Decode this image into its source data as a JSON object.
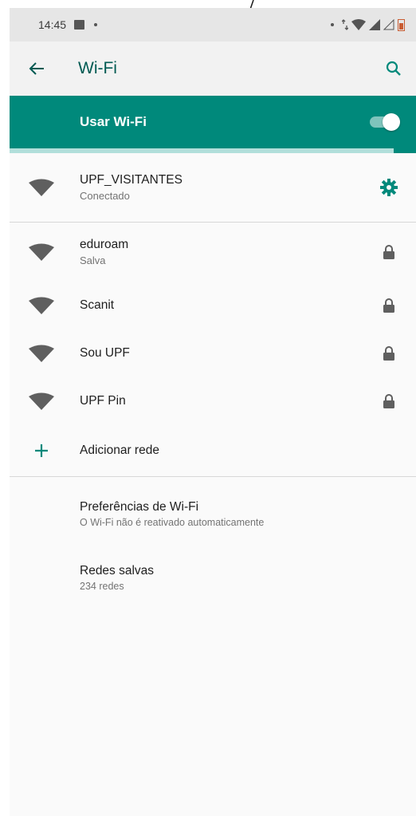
{
  "status_bar": {
    "time": "14:45"
  },
  "app_bar": {
    "title": "Wi-Fi"
  },
  "master_switch": {
    "label": "Usar Wi-Fi",
    "enabled": true
  },
  "connected": {
    "ssid": "UPF_VISITANTES",
    "status": "Conectado"
  },
  "networks": [
    {
      "ssid": "eduroam",
      "status": "Salva",
      "locked": true
    },
    {
      "ssid": "Scanit",
      "status": "",
      "locked": true
    },
    {
      "ssid": "Sou UPF",
      "status": "",
      "locked": true
    },
    {
      "ssid": "UPF Pin",
      "status": "",
      "locked": true
    }
  ],
  "add_network": {
    "label": "Adicionar rede"
  },
  "preferences": {
    "title": "Preferências de Wi-Fi",
    "summary": "O Wi-Fi não é reativado automaticamente"
  },
  "saved_networks": {
    "title": "Redes salvas",
    "summary": "234 redes"
  },
  "colors": {
    "accent": "#00897b",
    "title": "#005a52",
    "icon": "#5f5f5f"
  }
}
